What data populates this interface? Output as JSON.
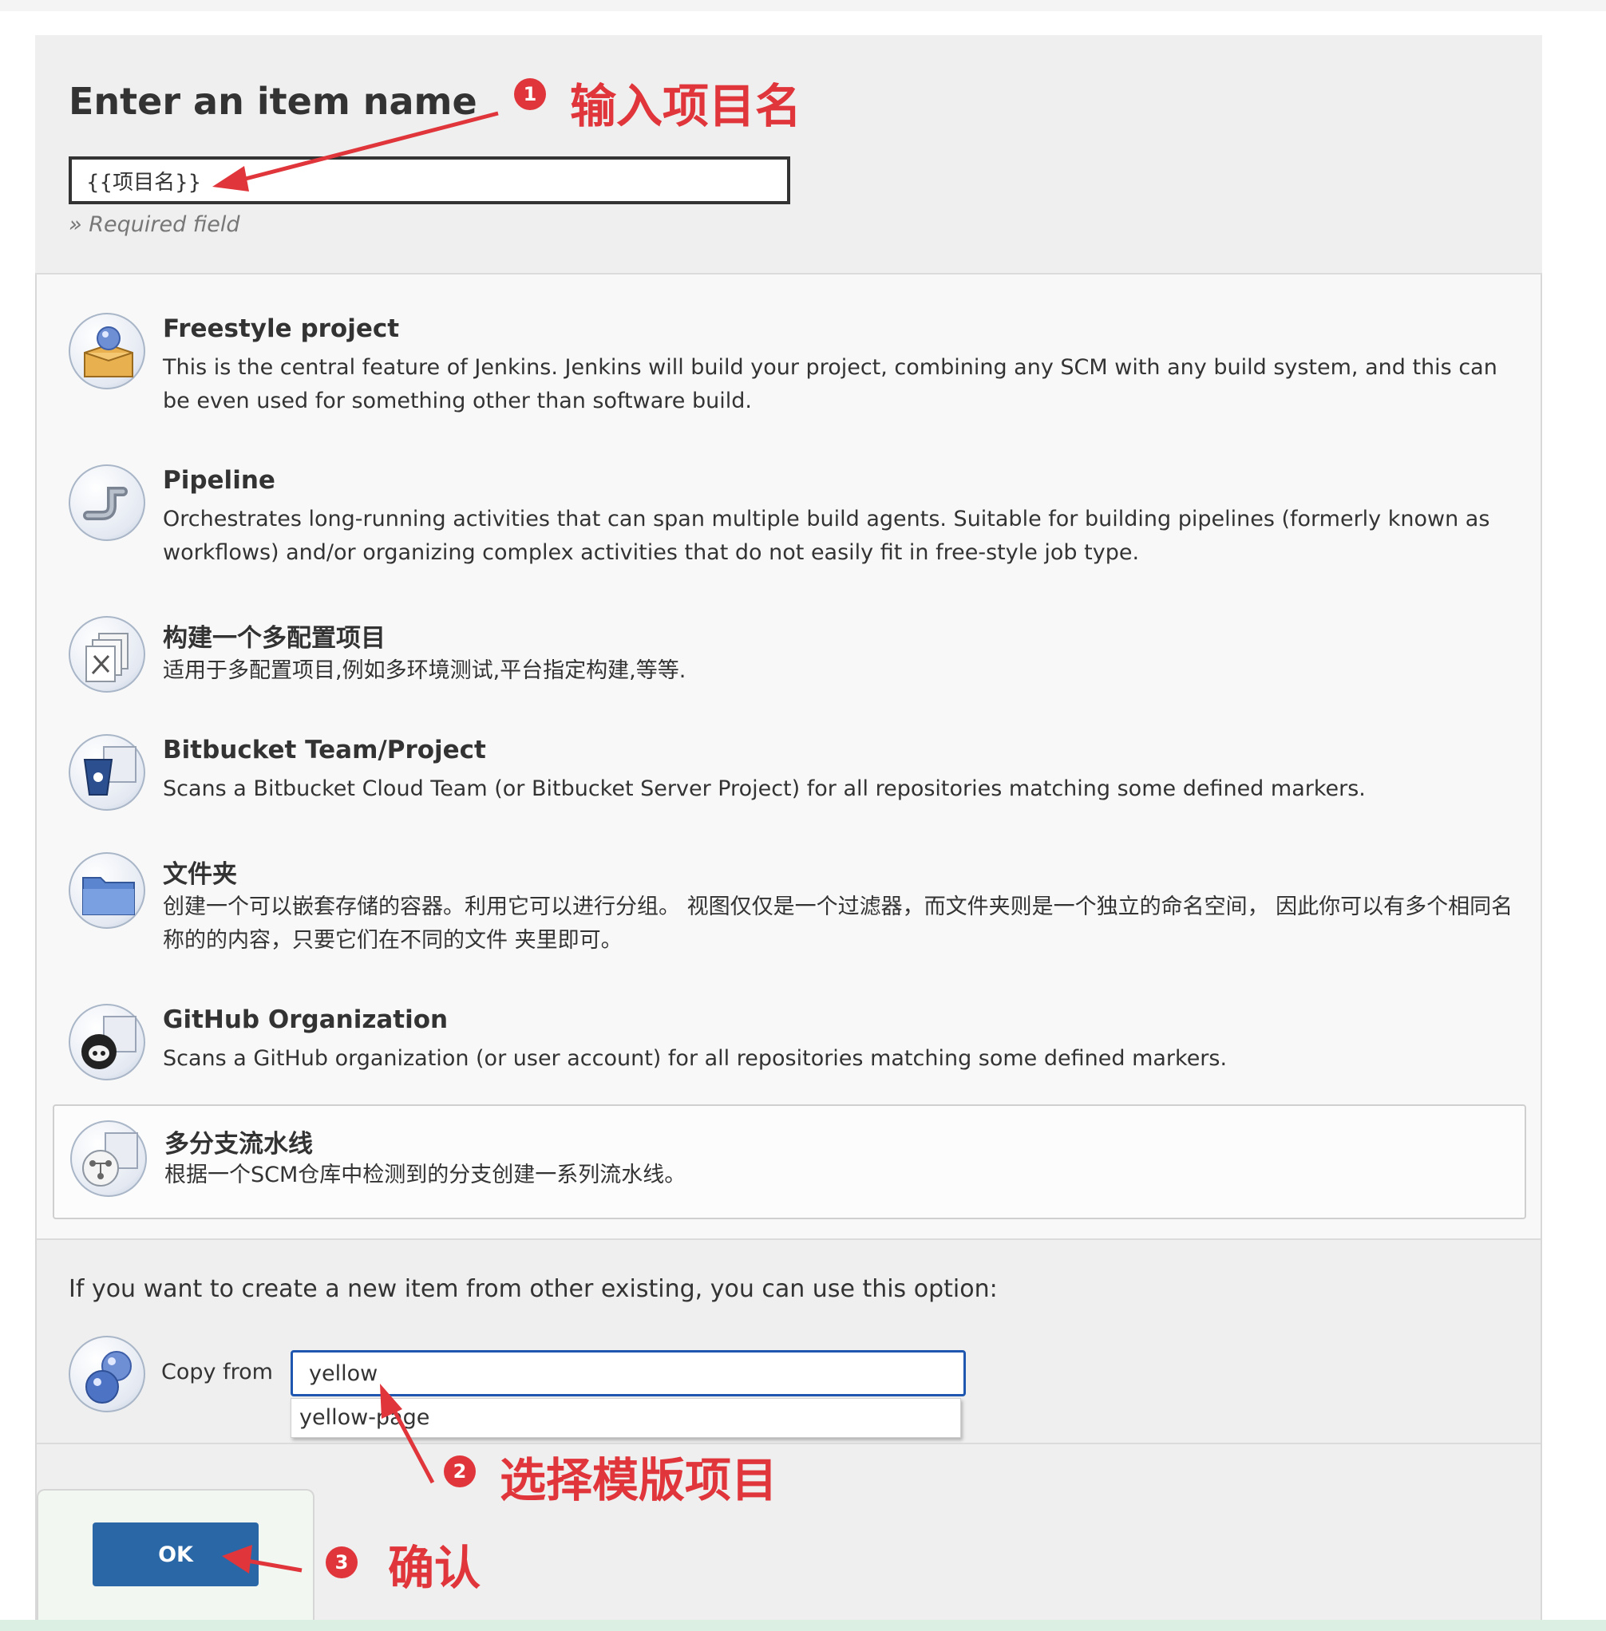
{
  "form": {
    "title": "Enter an item name",
    "name_value": "{{项目名}}",
    "required_note": "» Required field"
  },
  "item_types": [
    {
      "title": "Freestyle project",
      "description": "This is the central feature of Jenkins. Jenkins will build your project, combining any SCM with any build system, and this can be even used for something other than software build.",
      "icon": "freestyle-box-icon"
    },
    {
      "title": "Pipeline",
      "description": "Orchestrates long-running activities that can span multiple build agents. Suitable for building pipelines (formerly known as workflows) and/or organizing complex activities that do not easily fit in free-style job type.",
      "icon": "pipeline-pipe-icon"
    },
    {
      "title": "构建一个多配置项目",
      "description": "适用于多配置项目,例如多环境测试,平台指定构建,等等.",
      "icon": "multi-config-tools-icon"
    },
    {
      "title": "Bitbucket Team/Project",
      "description": "Scans a Bitbucket Cloud Team (or Bitbucket Server Project) for all repositories matching some defined markers.",
      "icon": "bitbucket-icon"
    },
    {
      "title": "文件夹",
      "description": "创建一个可以嵌套存储的容器。利用它可以进行分组。 视图仅仅是一个过滤器，而文件夹则是一个独立的命名空间， 因此你可以有多个相同名称的的内容，只要它们在不同的文件 夹里即可。",
      "icon": "folder-icon"
    },
    {
      "title": "GitHub Organization",
      "description": "Scans a GitHub organization (or user account) for all repositories matching some defined markers.",
      "icon": "github-octocat-icon"
    },
    {
      "title": "多分支流水线",
      "description": "根据一个SCM仓库中检测到的分支创建一系列流水线。",
      "icon": "multibranch-icon"
    }
  ],
  "copy": {
    "prompt": "If you want to create a new item from other existing, you can use this option:",
    "label": "Copy from",
    "value": "yellow",
    "suggestion": "yellow-page"
  },
  "actions": {
    "ok_label": "OK"
  },
  "annotations": [
    {
      "num": "1",
      "text": "输入项目名"
    },
    {
      "num": "2",
      "text": "选择模版项目"
    },
    {
      "num": "3",
      "text": "确认"
    }
  ],
  "colors": {
    "annotation": "#e0363b",
    "ok_button": "#2a67a6",
    "input_focus": "#1f56b0"
  }
}
